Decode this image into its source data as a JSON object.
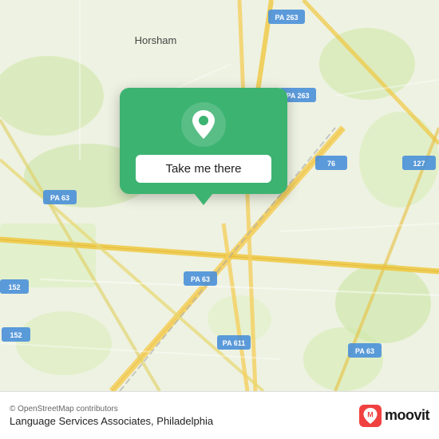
{
  "map": {
    "background_color": "#e8efda",
    "center_label": "Horsham",
    "road_color": "#f5c842",
    "highway_color": "#f0d080"
  },
  "popup": {
    "button_label": "Take me there",
    "background_color": "#3cb371"
  },
  "bottom_bar": {
    "copyright": "© OpenStreetMap contributors",
    "location_title": "Language Services Associates, Philadelphia",
    "moovit_label": "moovit"
  },
  "road_labels": [
    "PA 263",
    "PA 263",
    "PA 63",
    "PA 63",
    "PA 611",
    "PA 63",
    "152",
    "152",
    "76",
    "127"
  ]
}
